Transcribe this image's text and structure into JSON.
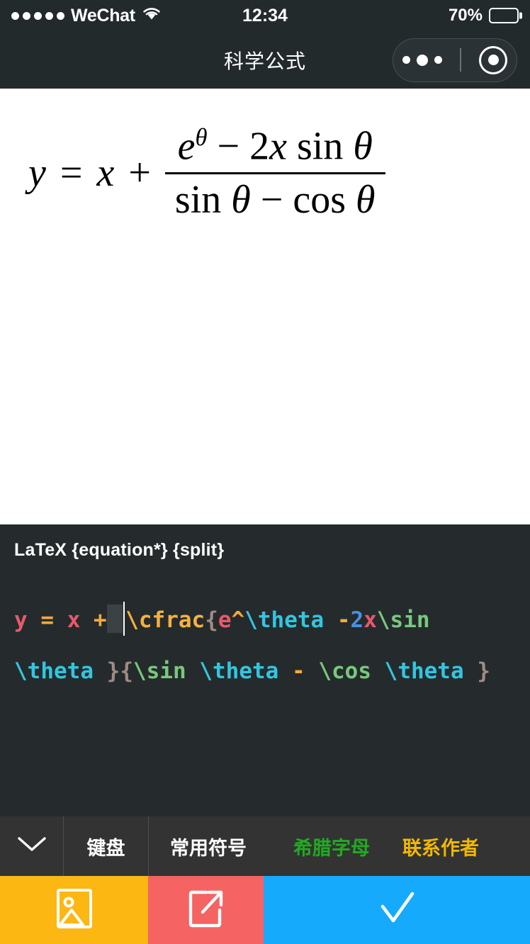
{
  "status_bar": {
    "carrier": "WeChat",
    "signal_dots": 5,
    "wifi_icon": "wifi-icon",
    "time": "12:34",
    "battery_percent": "70%",
    "battery_level": 70
  },
  "nav_bar": {
    "title": "科学公式",
    "capsule": {
      "menu_icon": "more-dots-icon",
      "close_icon": "target-circle-icon"
    }
  },
  "formula_preview": {
    "rendered_latex": "y = x + \\cfrac{e^\\theta -2x\\sin \\theta }{\\sin \\theta - \\cos \\theta }",
    "lhs_variable": "y",
    "equals": "=",
    "term_x": "x",
    "plus": "+",
    "numerator": "e^θ − 2x sin θ",
    "denominator": "sin θ − cos θ",
    "num_base": "e",
    "num_exp": "θ",
    "num_minus": "−",
    "num_coeff": "2",
    "num_var": "x",
    "num_fn": "sin",
    "num_fn_arg": "θ",
    "den_fn1": "sin",
    "den_arg1": "θ",
    "den_minus": "−",
    "den_fn2": "cos",
    "den_arg2": "θ"
  },
  "latex_editor": {
    "header": "LaTeX {equation*} {split}",
    "raw_source": "y = x + \\cfrac{e^\\theta -2x\\sin \\theta }{\\sin \\theta - \\cos \\theta }",
    "tokens": [
      {
        "text": "y",
        "type": "var"
      },
      {
        "text": " ",
        "type": "plain"
      },
      {
        "text": "=",
        "type": "op"
      },
      {
        "text": " ",
        "type": "plain"
      },
      {
        "text": "x",
        "type": "var"
      },
      {
        "text": " ",
        "type": "plain"
      },
      {
        "text": "+",
        "type": "op"
      },
      {
        "text": "SELECTION",
        "type": "selection"
      },
      {
        "text": "CARET",
        "type": "caret"
      },
      {
        "text": "\\cfrac",
        "type": "cmd"
      },
      {
        "text": "{",
        "type": "brace"
      },
      {
        "text": "e",
        "type": "var"
      },
      {
        "text": "^",
        "type": "op"
      },
      {
        "text": "\\theta",
        "type": "greek"
      },
      {
        "text": " ",
        "type": "plain"
      },
      {
        "text": "-",
        "type": "op"
      },
      {
        "text": "2",
        "type": "num"
      },
      {
        "text": "x",
        "type": "var"
      },
      {
        "text": "\\sin",
        "type": "fn"
      },
      {
        "text": " ",
        "type": "plain"
      },
      {
        "text": "\\theta",
        "type": "greek"
      },
      {
        "text": " ",
        "type": "plain"
      },
      {
        "text": "}",
        "type": "brace"
      },
      {
        "text": "{",
        "type": "brace"
      },
      {
        "text": "\\sin",
        "type": "fn"
      },
      {
        "text": " ",
        "type": "plain"
      },
      {
        "text": "\\theta",
        "type": "greek"
      },
      {
        "text": " ",
        "type": "plain"
      },
      {
        "text": "-",
        "type": "op"
      },
      {
        "text": " ",
        "type": "plain"
      },
      {
        "text": "\\cos",
        "type": "fn"
      },
      {
        "text": " ",
        "type": "plain"
      },
      {
        "text": "\\theta",
        "type": "greek"
      },
      {
        "text": " ",
        "type": "plain"
      },
      {
        "text": "}",
        "type": "brace"
      }
    ]
  },
  "key_toolbar": {
    "collapse_icon": "chevron-down-icon",
    "items": [
      {
        "label": "键盘",
        "color": "#ffffff"
      },
      {
        "label": "常用符号",
        "color": "#ffffff"
      },
      {
        "label": "希腊字母",
        "color": "#22AA22"
      },
      {
        "label": "联系作者",
        "color": "#F2B900"
      }
    ]
  },
  "action_bar": {
    "buttons": [
      {
        "name": "insert-image-button",
        "icon": "image-icon",
        "color": "#FCB712"
      },
      {
        "name": "share-button",
        "icon": "external-link-icon",
        "color": "#F56363"
      },
      {
        "name": "confirm-button",
        "icon": "check-icon",
        "color": "#16AAFC"
      }
    ]
  },
  "colors": {
    "header_bg": "#232A2C",
    "editor_bg": "#252B2D",
    "toolbar_bg": "#333333",
    "canvas_bg": "#FFFFFF",
    "accent_orange": "#FCB712",
    "accent_red": "#F56363",
    "accent_blue": "#16AAFC",
    "accent_green": "#22AA22",
    "accent_yellow": "#F2B900"
  }
}
